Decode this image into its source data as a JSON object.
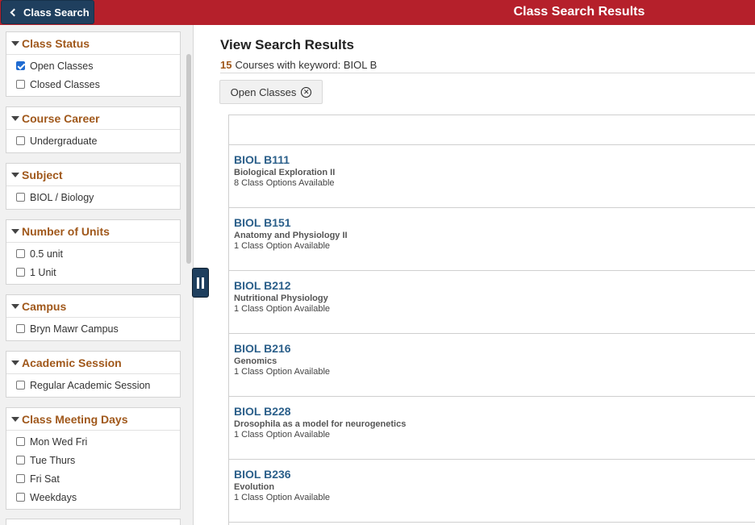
{
  "header": {
    "back_label": "Class Search",
    "title": "Class Search Results"
  },
  "facets": [
    {
      "title": "Class Status",
      "options": [
        {
          "label": "Open Classes",
          "checked": true
        },
        {
          "label": "Closed Classes",
          "checked": false
        }
      ]
    },
    {
      "title": "Course Career",
      "options": [
        {
          "label": "Undergraduate",
          "checked": false
        }
      ]
    },
    {
      "title": "Subject",
      "options": [
        {
          "label": "BIOL / Biology",
          "checked": false
        }
      ]
    },
    {
      "title": "Number of Units",
      "options": [
        {
          "label": "0.5 unit",
          "checked": false
        },
        {
          "label": "1 Unit",
          "checked": false
        }
      ]
    },
    {
      "title": "Campus",
      "options": [
        {
          "label": "Bryn Mawr Campus",
          "checked": false
        }
      ]
    },
    {
      "title": "Academic Session",
      "options": [
        {
          "label": "Regular Academic Session",
          "checked": false
        }
      ]
    },
    {
      "title": "Class Meeting Days",
      "options": [
        {
          "label": "Mon Wed Fri",
          "checked": false
        },
        {
          "label": "Tue Thurs",
          "checked": false
        },
        {
          "label": "Fri Sat",
          "checked": false
        },
        {
          "label": "Weekdays",
          "checked": false
        }
      ]
    }
  ],
  "main": {
    "title": "View Search Results",
    "count": "15",
    "count_text": "Courses with keyword: BIOL B",
    "filter_pill": "Open Classes"
  },
  "courses": [
    {
      "code": "BIOL B111",
      "name": "Biological Exploration II",
      "options": "8 Class Options Available"
    },
    {
      "code": "BIOL B151",
      "name": "Anatomy and Physiology II",
      "options": "1 Class Option Available"
    },
    {
      "code": "BIOL B212",
      "name": "Nutritional Physiology",
      "options": "1 Class Option Available"
    },
    {
      "code": "BIOL B216",
      "name": "Genomics",
      "options": "1 Class Option Available"
    },
    {
      "code": "BIOL B228",
      "name": "Drosophila as a model for neurogenetics",
      "options": "1 Class Option Available"
    },
    {
      "code": "BIOL B236",
      "name": "Evolution",
      "options": "1 Class Option Available"
    }
  ]
}
